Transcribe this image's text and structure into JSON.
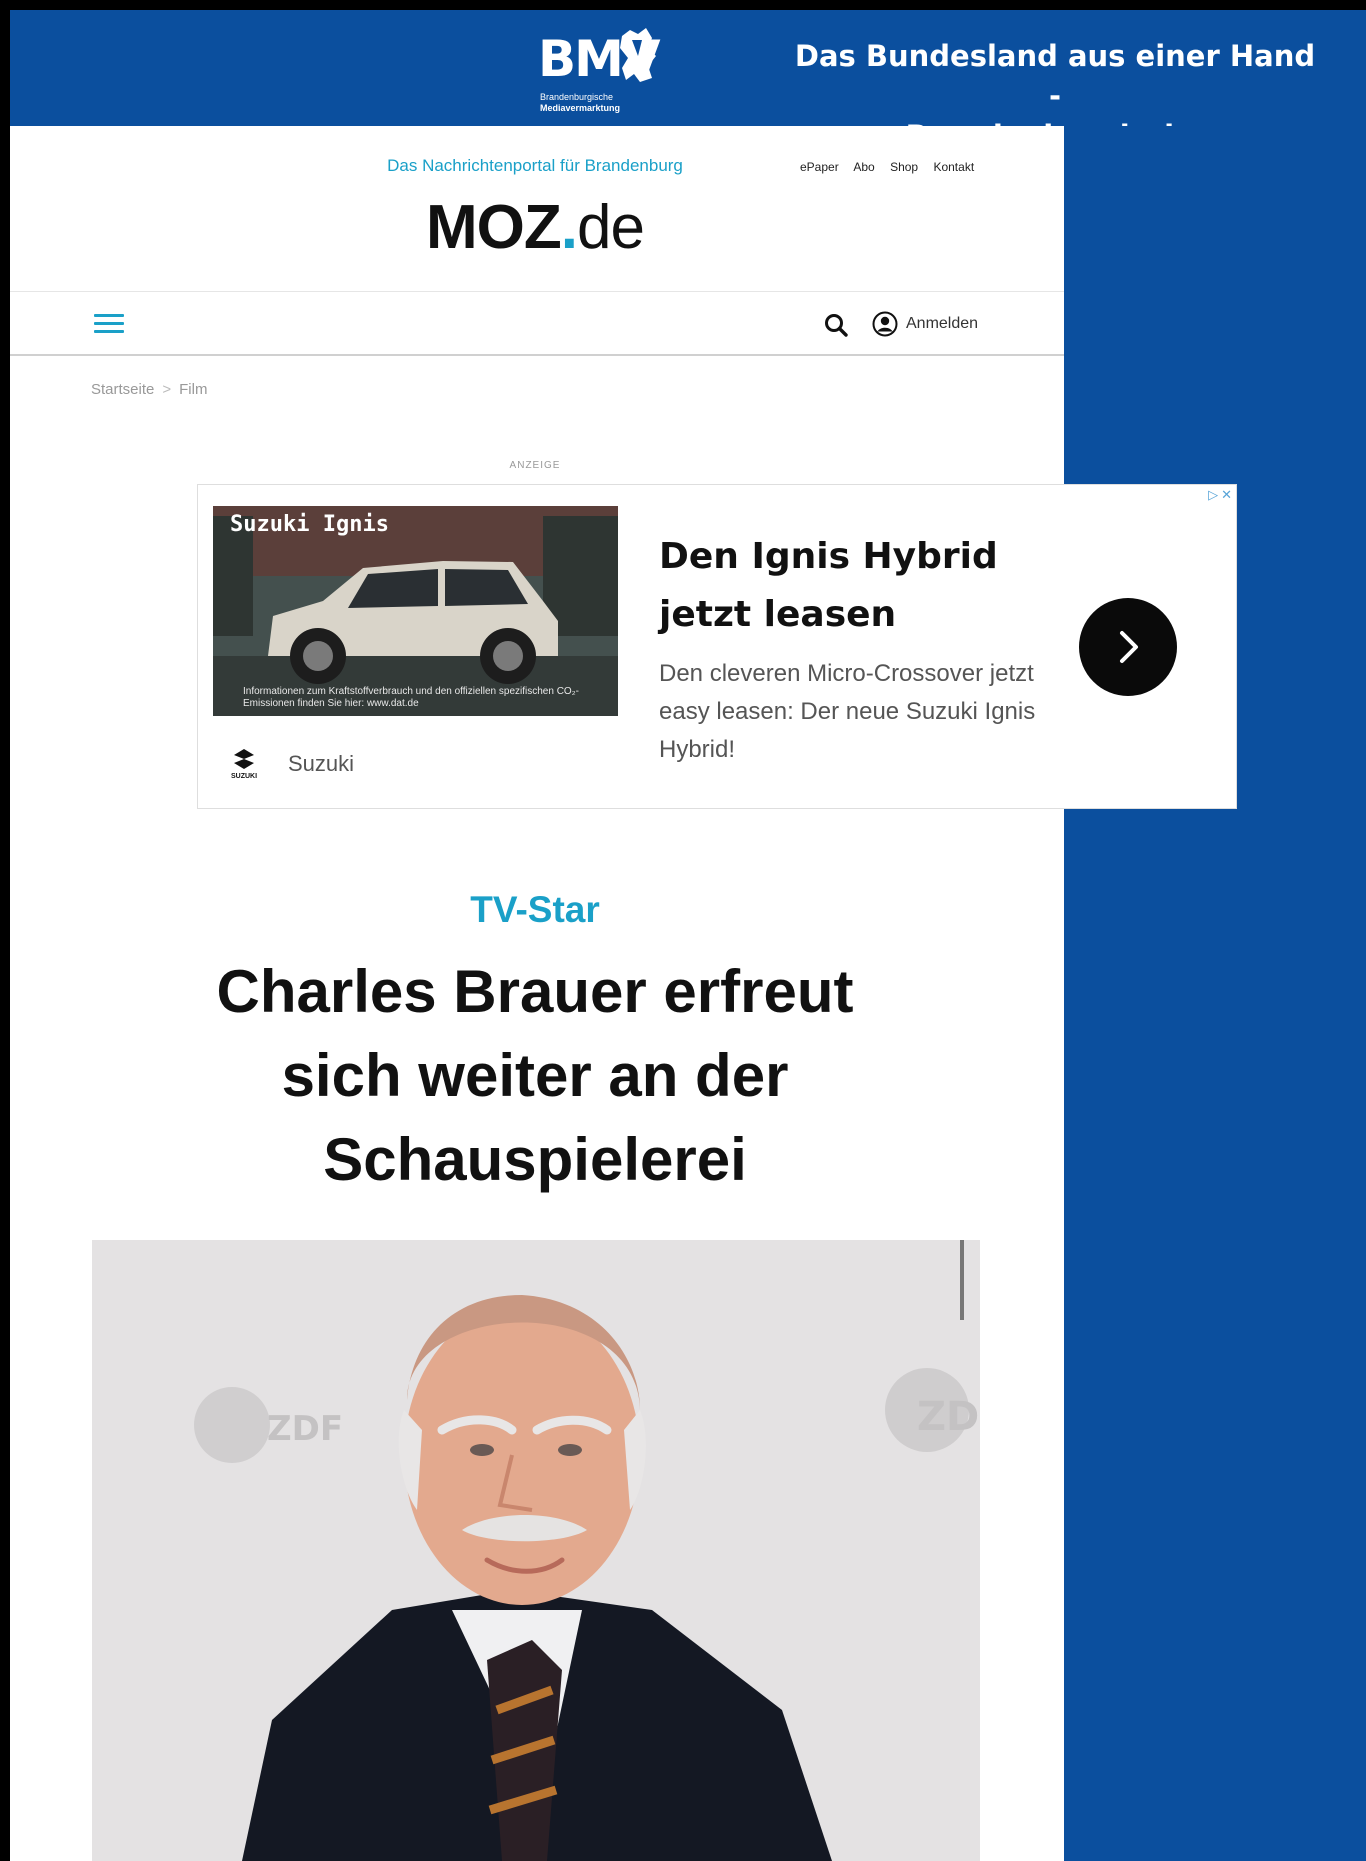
{
  "banner": {
    "logo_text": "BMV",
    "logo_sub_line1": "Brandenburgische",
    "logo_sub_line2": "Mediavermarktung",
    "slogan_line1": "Das Bundesland aus einer Hand -",
    "slogan_line2": "Brandenburgische Mediavermarktung.",
    "color": "#0b4f9e"
  },
  "site": {
    "tagline": "Das Nachrichtenportal für Brandenburg",
    "top_links": [
      "ePaper",
      "Abo",
      "Shop",
      "Kontakt"
    ],
    "logo_main": "MOZ",
    "logo_dot": ".",
    "logo_tld": "de",
    "accent_color": "#1aa0c8"
  },
  "nav": {
    "menu_icon": "hamburger-menu-icon",
    "search_icon": "search-icon",
    "account_icon": "user-account-icon",
    "login_label": "Anmelden"
  },
  "breadcrumb": {
    "items": [
      "Startseite",
      "Film"
    ],
    "separator": ">"
  },
  "ad": {
    "label": "ANZEIGE",
    "image_caption": "Suzuki Ignis",
    "image_note": "Informationen zum Kraftstoffverbrauch und den offiziellen spezifischen CO₂-Emissionen finden Sie hier: www.dat.de",
    "brand_name": "Suzuki",
    "brand_logo_text": "SUZUKI",
    "headline": "Den Ignis Hybrid jetzt leasen",
    "description": "Den cleveren Micro-Crossover jetzt easy leasen: Der neue Suzuki Ignis Hybrid!",
    "cta_icon": "chevron-right-icon",
    "adchoices_icon": "adchoices-icon",
    "close_icon": "close-icon"
  },
  "article": {
    "kicker": "TV-Star",
    "headline": "Charles Brauer erfreut sich weiter an der Schauspielerei",
    "image_watermark": "ZDF"
  }
}
